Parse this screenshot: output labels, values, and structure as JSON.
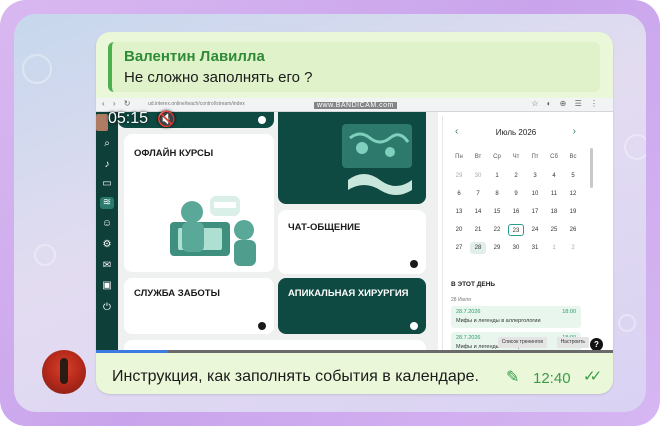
{
  "reply": {
    "author": "Валентин Лавилла",
    "text": "Не сложно заполнять его ?"
  },
  "browser": {
    "url": "ud.interex.online/teach/control/stream/index",
    "nav_icons": "‹ › ↻",
    "ext_icons": "☆ ◐ ⊕ ☰ ⋮"
  },
  "watermark": "www.BANDICAM.com",
  "video": {
    "time": "05:15",
    "mute_icon": "🔇",
    "progress_fraction": 0.14
  },
  "rail_icons": [
    "search-icon",
    "bell-icon",
    "desktop-icon",
    "layers-icon",
    "users-icon",
    "gear-icon",
    "mail-icon",
    "bag-icon",
    "logout-icon"
  ],
  "tiles": {
    "offline": "ОФЛАЙН КУРСЫ",
    "chat": "ЧАТ-ОБЩЕНИЕ",
    "care": "СЛУЖБА ЗАБОТЫ",
    "surgery": "АПИКАЛЬНАЯ ХИРУРГИЯ"
  },
  "calendar": {
    "month": "Июль 2026",
    "prev": "‹",
    "next": "›",
    "weekdays": [
      "Пн",
      "Вт",
      "Ср",
      "Чт",
      "Пт",
      "Сб",
      "Вс"
    ],
    "weeks": [
      [
        "29",
        "30",
        "1",
        "2",
        "3",
        "4",
        "5"
      ],
      [
        "6",
        "7",
        "8",
        "9",
        "10",
        "11",
        "12"
      ],
      [
        "13",
        "14",
        "15",
        "16",
        "17",
        "18",
        "19"
      ],
      [
        "20",
        "21",
        "22",
        "23",
        "24",
        "25",
        "26"
      ],
      [
        "27",
        "28",
        "29",
        "30",
        "31",
        "1",
        "2"
      ]
    ],
    "selected_day": "23",
    "today_day": "28",
    "this_day_title": "В ЭТОТ ДЕНЬ",
    "this_day_date": "28 Июля",
    "events": [
      {
        "date": "28.7.2026",
        "time": "18:00",
        "name": "Мифы и легенды в аллергологии"
      },
      {
        "date": "28.7.2026",
        "time": "18:00",
        "name": "Мифы и легенды в аллергологии"
      }
    ],
    "btn_trainers": "Список тренингов",
    "btn_settings": "Настроить",
    "help": "?"
  },
  "message": {
    "caption": "Инструкция, как заполнять события в календаре.",
    "time": "12:40",
    "pin_icon": "pin-icon",
    "ticks": "✓✓"
  },
  "colors": {
    "bubble": "#eaf7d8",
    "reply_bar": "#4caf50",
    "accent_green": "#2e8b36",
    "rail": "#0f3f39",
    "tile_dark": "#0e4a42"
  }
}
